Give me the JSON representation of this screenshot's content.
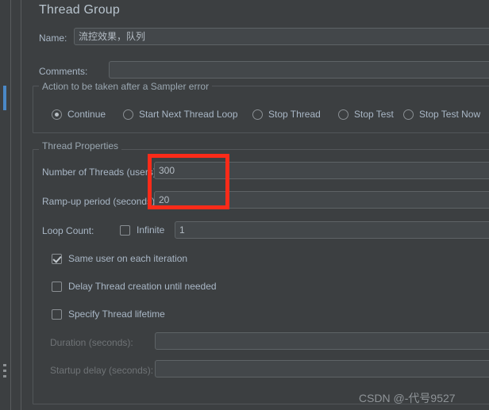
{
  "window": {
    "title": "Thread Group"
  },
  "form": {
    "name_label": "Name:",
    "name_value": "流控效果，队列",
    "comments_label": "Comments:",
    "comments_value": ""
  },
  "sampler_error_group": {
    "title": "Action to be taken after a Sampler error",
    "options": [
      {
        "label": "Continue",
        "selected": true
      },
      {
        "label": "Start Next Thread Loop",
        "selected": false
      },
      {
        "label": "Stop Thread",
        "selected": false
      },
      {
        "label": "Stop Test",
        "selected": false
      },
      {
        "label": "Stop Test Now",
        "selected": false
      }
    ]
  },
  "thread_properties": {
    "title": "Thread Properties",
    "num_threads_label": "Number of Threads (users):",
    "num_threads_value": "300",
    "rampup_label": "Ramp-up period (seconds):",
    "rampup_value": "20",
    "loop_count_label": "Loop Count:",
    "infinite_label": "Infinite",
    "infinite_checked": false,
    "loop_count_value": "1",
    "same_user_label": "Same user on each iteration",
    "same_user_checked": true,
    "delay_thread_label": "Delay Thread creation until needed",
    "delay_thread_checked": false,
    "specify_lifetime_label": "Specify Thread lifetime",
    "specify_lifetime_checked": false,
    "duration_label": "Duration (seconds):",
    "duration_value": "",
    "startup_delay_label": "Startup delay (seconds):",
    "startup_delay_value": ""
  },
  "annotation": {
    "highlight_color": "#fb2b19"
  },
  "watermark": {
    "text": "CSDN @-代号9527"
  }
}
